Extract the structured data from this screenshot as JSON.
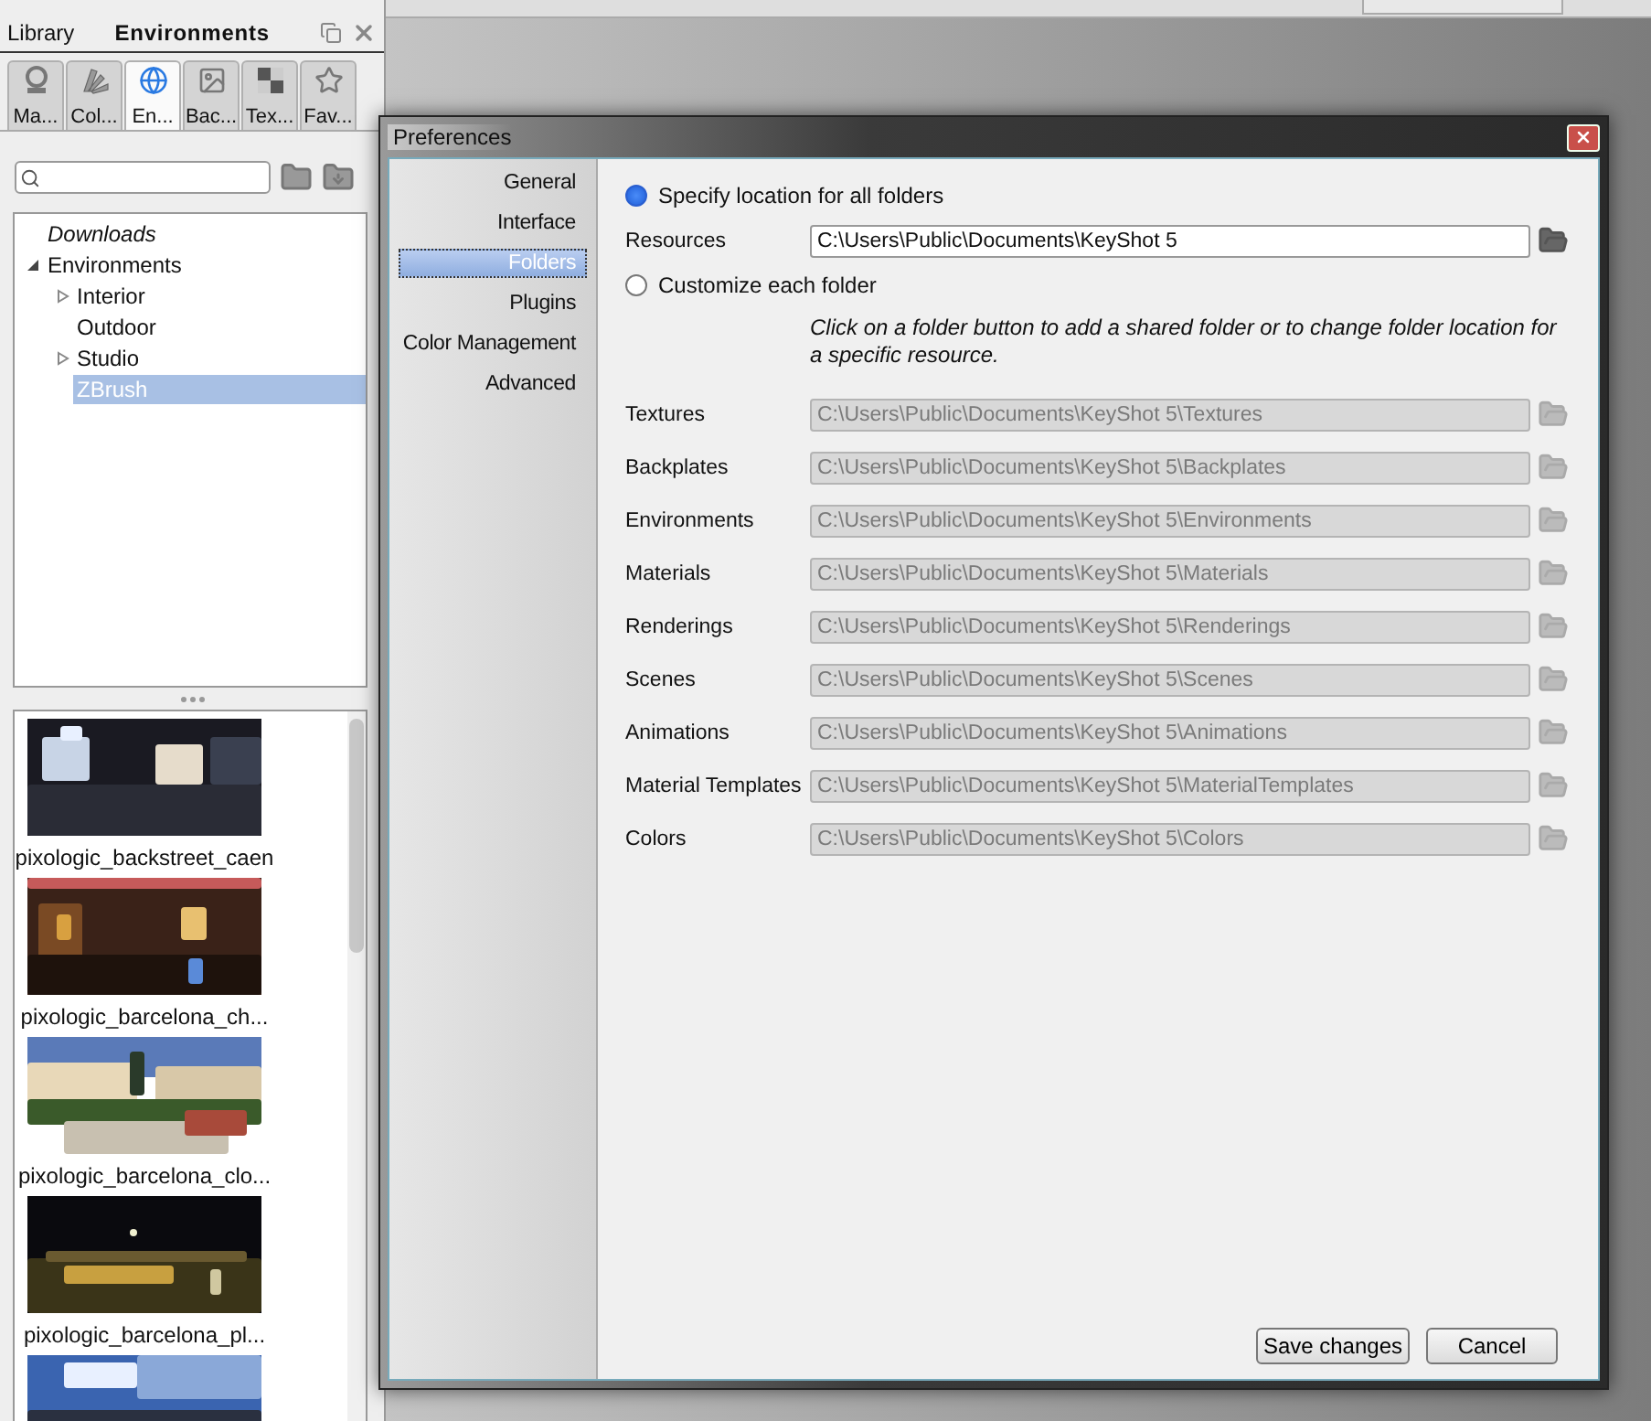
{
  "library_panel": {
    "tabs": [
      {
        "label": "Library",
        "selected": false
      },
      {
        "label": "Environments",
        "selected": true
      }
    ],
    "categories": [
      {
        "label": "Ma...",
        "kind": "materials",
        "selected": false
      },
      {
        "label": "Col...",
        "kind": "colors",
        "selected": false
      },
      {
        "label": "En...",
        "kind": "environments",
        "selected": true
      },
      {
        "label": "Bac...",
        "kind": "backplates",
        "selected": false
      },
      {
        "label": "Tex...",
        "kind": "textures",
        "selected": false
      },
      {
        "label": "Fav...",
        "kind": "favorites",
        "selected": false
      }
    ],
    "tree": [
      {
        "label": "Downloads",
        "kind": "shortcut",
        "selected": false
      },
      {
        "label": "Environments",
        "selected": false,
        "expanded": true,
        "children": [
          {
            "label": "Interior",
            "selected": false,
            "expanded": false
          },
          {
            "label": "Outdoor",
            "selected": false
          },
          {
            "label": "Studio",
            "selected": false,
            "expanded": false
          },
          {
            "label": "ZBrush",
            "selected": true
          }
        ]
      }
    ],
    "thumbnails": [
      {
        "name": "pixologic_backstreet_caen",
        "kind": "picture"
      },
      {
        "name": "pixologic_barcelona_ch...",
        "kind": "picture"
      },
      {
        "name": "pixologic_barcelona_clo...",
        "kind": "picture"
      },
      {
        "name": "pixologic_barcelona_pl...",
        "kind": "picture"
      },
      {
        "kind": "picture"
      }
    ]
  },
  "dialog": {
    "title": "Preferences",
    "nav": [
      {
        "label": "General",
        "selected": false
      },
      {
        "label": "Interface",
        "selected": false
      },
      {
        "label": "Folders",
        "selected": true
      },
      {
        "label": "Plugins",
        "selected": false
      },
      {
        "label": "Color Management",
        "selected": false
      },
      {
        "label": "Advanced",
        "selected": false
      }
    ],
    "location_modes": [
      {
        "label": "Specify location for all folders",
        "selected": true
      },
      {
        "label": "Customize each folder",
        "selected": false
      }
    ],
    "resources": {
      "label": "Resources",
      "value": "C:\\Users\\Public\\Documents\\KeyShot 5",
      "disabled": false
    },
    "note": "Click on a folder button to add a shared folder or to change folder location for a specific resource.",
    "folders": [
      {
        "label": "Textures",
        "value": "C:\\Users\\Public\\Documents\\KeyShot 5\\Textures",
        "disabled": true
      },
      {
        "label": "Backplates",
        "value": "C:\\Users\\Public\\Documents\\KeyShot 5\\Backplates",
        "disabled": true
      },
      {
        "label": "Environments",
        "value": "C:\\Users\\Public\\Documents\\KeyShot 5\\Environments",
        "disabled": true
      },
      {
        "label": "Materials",
        "value": "C:\\Users\\Public\\Documents\\KeyShot 5\\Materials",
        "disabled": true
      },
      {
        "label": "Renderings",
        "value": "C:\\Users\\Public\\Documents\\KeyShot 5\\Renderings",
        "disabled": true
      },
      {
        "label": "Scenes",
        "value": "C:\\Users\\Public\\Documents\\KeyShot 5\\Scenes",
        "disabled": true
      },
      {
        "label": "Animations",
        "value": "C:\\Users\\Public\\Documents\\KeyShot 5\\Animations",
        "disabled": true
      },
      {
        "label": "Material Templates",
        "value": "C:\\Users\\Public\\Documents\\KeyShot 5\\MaterialTemplates",
        "disabled": true
      },
      {
        "label": "Colors",
        "value": "C:\\Users\\Public\\Documents\\KeyShot 5\\Colors",
        "disabled": true
      }
    ],
    "buttons": [
      "Save changes",
      "Cancel"
    ]
  }
}
